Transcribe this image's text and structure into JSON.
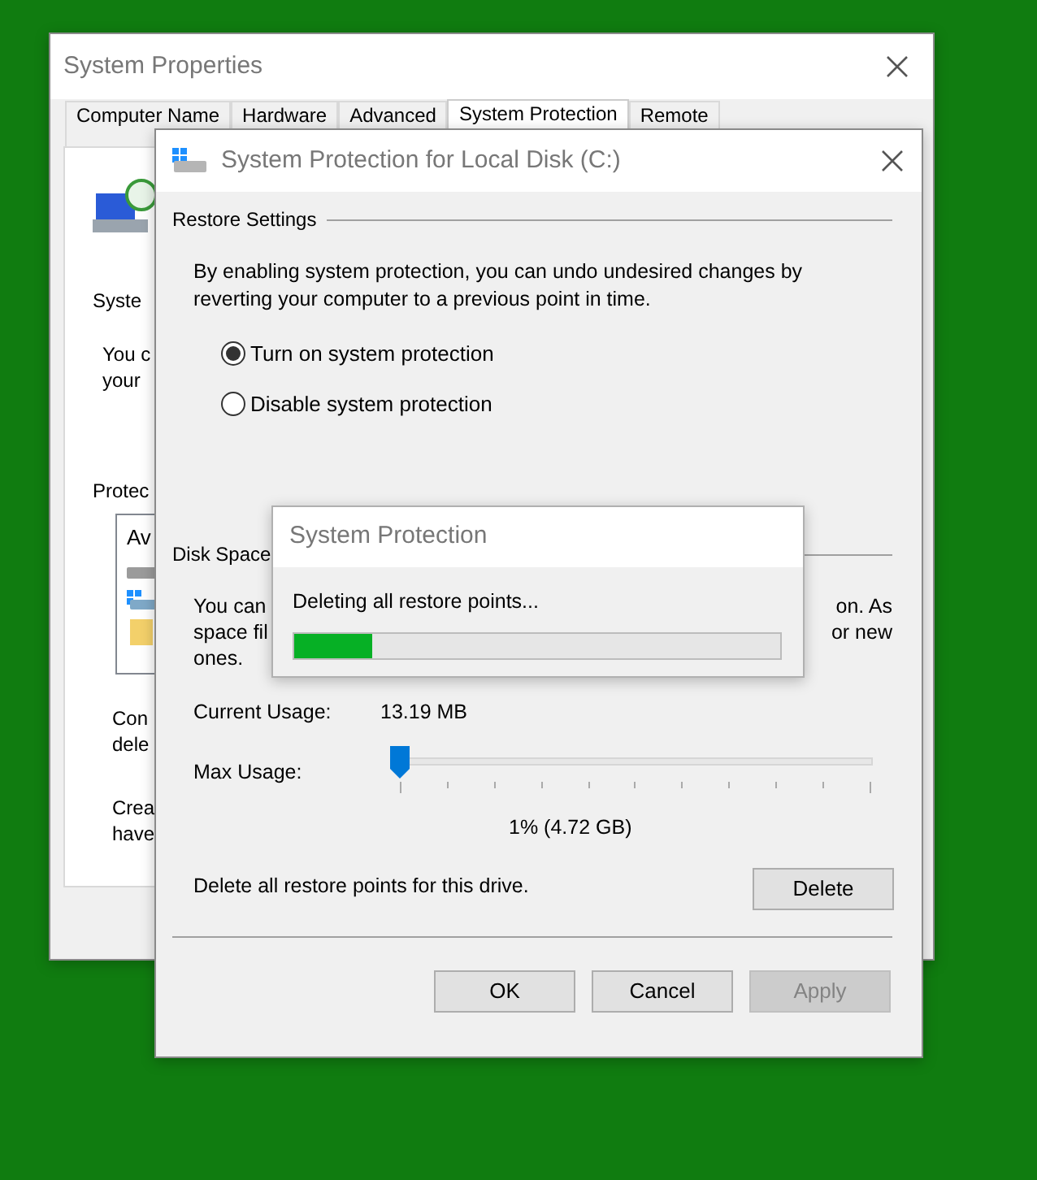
{
  "back_window": {
    "title": "System Properties",
    "tabs": [
      {
        "label": "Computer Name",
        "selected": false
      },
      {
        "label": "Hardware",
        "selected": false
      },
      {
        "label": "Advanced",
        "selected": false
      },
      {
        "label": "System Protection",
        "selected": true
      },
      {
        "label": "Remote",
        "selected": false
      }
    ],
    "texts": [
      "Syste",
      "You c",
      "your",
      "Protec"
    ],
    "list": {
      "header": "Av"
    },
    "texts_below": [
      "Con",
      "dele",
      "Crea",
      "have"
    ]
  },
  "dialog": {
    "title": "System Protection for Local Disk (C:)",
    "restore_settings": {
      "heading": "Restore Settings",
      "description": "By enabling system protection, you can undo undesired changes by reverting your computer to a previous point in time.",
      "options": [
        {
          "label": "Turn on system protection",
          "selected": true
        },
        {
          "label": "Disable system protection",
          "selected": false
        }
      ]
    },
    "disk_space": {
      "heading": "Disk Space",
      "description_left": [
        "You can",
        "space fil",
        "ones."
      ],
      "description_right": [
        "on. As",
        "or new"
      ],
      "current_usage_label": "Current Usage:",
      "current_usage": "13.19 MB",
      "max_usage_label": "Max Usage:",
      "max_usage": {
        "level": 0.0
      },
      "max_usage_reading": "1% (4.72 GB)",
      "delete_label": "Delete all restore points for this drive.",
      "delete_button": "Delete"
    },
    "buttons": [
      {
        "label": "OK",
        "disabled": false
      },
      {
        "label": "Cancel",
        "disabled": false
      },
      {
        "label": "Apply",
        "disabled": true
      }
    ]
  },
  "progress_window": {
    "title": "System Protection",
    "message": "Deleting all restore points...",
    "progress": {
      "level": 0.16
    }
  }
}
